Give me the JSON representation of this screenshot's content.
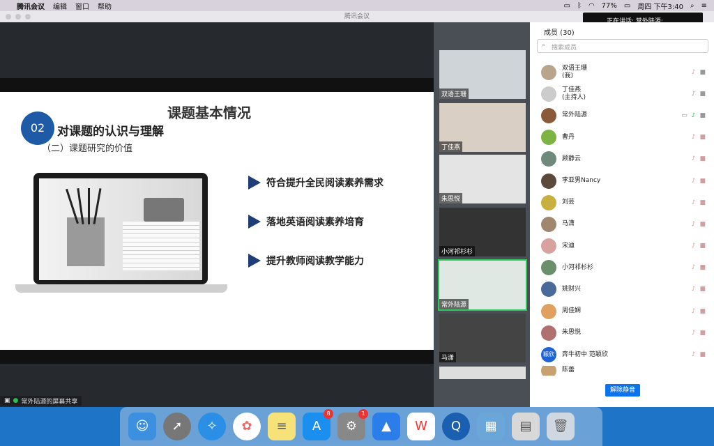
{
  "menubar": {
    "apple": "",
    "app": "腾讯会议",
    "edit": "编辑",
    "window": "窗口",
    "help": "帮助",
    "battery": "77%",
    "clock": "周四 下午3:40"
  },
  "window": {
    "title": "腾讯会议"
  },
  "speaking": {
    "text": "正在讲话: 常外陆源;"
  },
  "slide": {
    "title": "课题基本情况",
    "number": "02",
    "heading": "对课题的认识与理解",
    "subheading": "（二）课题研究的价值",
    "bullets": [
      "符合提升全民阅读素养需求",
      "落地英语阅读素养培育",
      "提升教师阅读教学能力"
    ]
  },
  "share_label": "常外陆源的屏幕共享",
  "gallery": [
    {
      "name": "双语王珊"
    },
    {
      "name": "丁佳燕"
    },
    {
      "name": "朱思悦"
    },
    {
      "name": "小河祁杉杉"
    },
    {
      "name": "常外陆源"
    },
    {
      "name": "马潇"
    }
  ],
  "panel": {
    "title": "成员 (30)",
    "search_placeholder": "搜索成员",
    "unmute_button": "解除静音"
  },
  "members": [
    {
      "name": "双语王珊",
      "role": "(我)"
    },
    {
      "name": "丁佳燕",
      "role": "(主持人)"
    },
    {
      "name": "常外陆源",
      "role": ""
    },
    {
      "name": "曹丹",
      "role": ""
    },
    {
      "name": "顾静云",
      "role": ""
    },
    {
      "name": "李亚男Nancy",
      "role": ""
    },
    {
      "name": "刘芸",
      "role": ""
    },
    {
      "name": "马潇",
      "role": ""
    },
    {
      "name": "宋迪",
      "role": ""
    },
    {
      "name": "小河祁杉杉",
      "role": ""
    },
    {
      "name": "姚财兴",
      "role": ""
    },
    {
      "name": "周佳娴",
      "role": ""
    },
    {
      "name": "朱思悦",
      "role": ""
    },
    {
      "name": "奔牛初中 范颖欣",
      "role": ""
    },
    {
      "name": "陈蕾",
      "role": ""
    }
  ],
  "member_avatar_text": {
    "fan": "颖欣"
  },
  "dock": {
    "badges": {
      "appstore": "8",
      "prefs": "1"
    }
  }
}
